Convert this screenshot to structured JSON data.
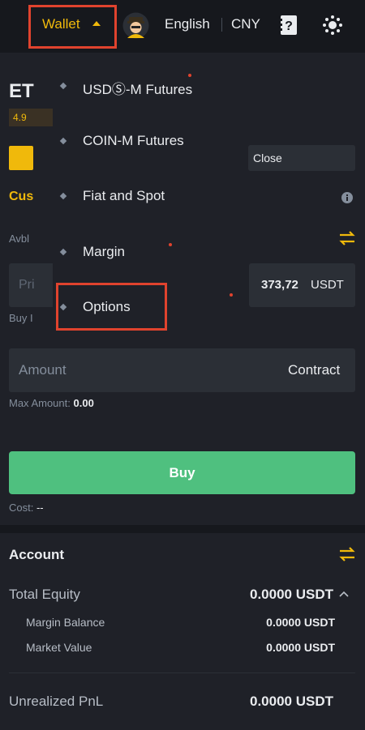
{
  "header": {
    "wallet_label": "Wallet",
    "language": "English",
    "currency": "CNY"
  },
  "background_peek": {
    "symbol_partial": "ET",
    "leverage_partial": "4.9",
    "mode_partial": "Cus",
    "avbl_partial": "Avbl",
    "price_placeholder_partial": "Pri",
    "buy_partial": "Buy I"
  },
  "wallet_menu": {
    "items": [
      {
        "label": "USDⓈ-M Futures"
      },
      {
        "label": "COIN-M Futures"
      },
      {
        "label": "Fiat and Spot"
      },
      {
        "label": "Margin"
      },
      {
        "label": "Options"
      }
    ]
  },
  "order_form": {
    "close_label": "Close",
    "price_value": "373,72",
    "price_unit": "USDT",
    "amount_placeholder": "Amount",
    "amount_unit": "Contract",
    "max_amount_label": "Max Amount:",
    "max_amount_value": "0.00",
    "buy_button": "Buy",
    "cost_label": "Cost:",
    "cost_value": "--"
  },
  "account": {
    "title": "Account",
    "total_equity_label": "Total Equity",
    "total_equity_value": "0.0000 USDT",
    "margin_balance_label": "Margin Balance",
    "margin_balance_value": "0.0000 USDT",
    "market_value_label": "Market Value",
    "market_value_value": "0.0000 USDT",
    "unrealized_pnl_label": "Unrealized PnL",
    "unrealized_pnl_value": "0.0000 USDT"
  },
  "colors": {
    "accent": "#f0b90b",
    "buy_green": "#4fc07f",
    "highlight_red": "#e0432e",
    "background": "#1f2128"
  }
}
